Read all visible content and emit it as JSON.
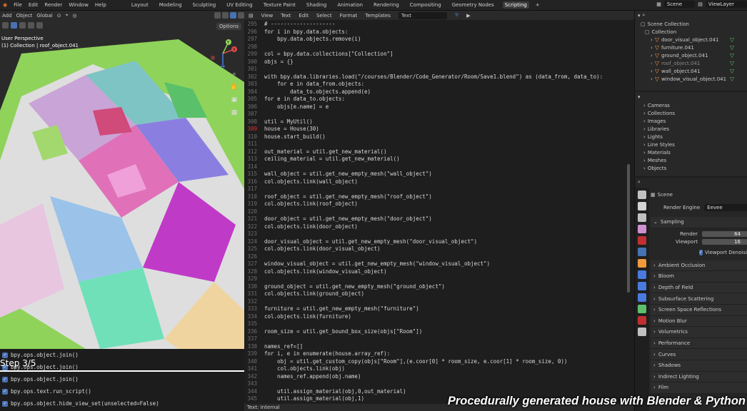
{
  "topbar": {
    "menus": [
      "File",
      "Edit",
      "Render",
      "Window",
      "Help"
    ],
    "workspaces": [
      "Layout",
      "Modeling",
      "Sculpting",
      "UV Editing",
      "Texture Paint",
      "Shading",
      "Animation",
      "Rendering",
      "Compositing",
      "Geometry Nodes",
      "Scripting"
    ],
    "active_workspace": "Scripting",
    "scene": "Scene",
    "view_layer": "ViewLayer"
  },
  "viewport": {
    "menus": [
      "Add",
      "Object"
    ],
    "transform": "Global",
    "options": "Options",
    "perspective": "User Perspective",
    "collection_info": "(1) Collection | roof_object.041",
    "gizmo_axes": [
      "X",
      "Y",
      "Z"
    ]
  },
  "console": {
    "lines": [
      "bpy.ops.object.join()",
      "bpy.ops.object.join()",
      "bpy.ops.object.join()",
      "bpy.ops.text.run_script()",
      "bpy.ops.object.hide_view_set(unselected=False)"
    ],
    "step": "Step 3/5"
  },
  "editor": {
    "menus": [
      "View",
      "Text",
      "Edit",
      "Select",
      "Format",
      "Templates"
    ],
    "text_name": "Text",
    "footer": "Text: Internal",
    "lines": [
      {
        "n": "295",
        "t": "# --------------------"
      },
      {
        "n": "296",
        "t": "for i in bpy.data.objects:"
      },
      {
        "n": "297",
        "t": "    bpy.data.objects.remove(i)"
      },
      {
        "n": "298",
        "t": ""
      },
      {
        "n": "299",
        "t": "col = bpy.data.collections[\"Collection\"]"
      },
      {
        "n": "300",
        "t": "objs = {}"
      },
      {
        "n": "301",
        "t": ""
      },
      {
        "n": "302",
        "t": "with bpy.data.libraries.load(\"/courses/Blender/Code_Generator/Room/Save1.blend\") as (data_from, data_to):"
      },
      {
        "n": "303",
        "t": "    for e in data_from.objects:"
      },
      {
        "n": "304",
        "t": "        data_to.objects.append(e)"
      },
      {
        "n": "305",
        "t": "for e in data_to.objects:"
      },
      {
        "n": "306",
        "t": "    objs[e.name] = e"
      },
      {
        "n": "307",
        "t": ""
      },
      {
        "n": "308",
        "t": "util = MyUtil()"
      },
      {
        "n": "309",
        "t": "house = House(30)"
      },
      {
        "n": "310",
        "t": "house.start_build()"
      },
      {
        "n": "311",
        "t": ""
      },
      {
        "n": "312",
        "t": "out_material = util.get_new_material()"
      },
      {
        "n": "313",
        "t": "ceiling_material = util.get_new_material()"
      },
      {
        "n": "314",
        "t": ""
      },
      {
        "n": "315",
        "t": "wall_object = util.get_new_empty_mesh(\"wall_object\")"
      },
      {
        "n": "316",
        "t": "col.objects.link(wall_object)"
      },
      {
        "n": "317",
        "t": ""
      },
      {
        "n": "318",
        "t": "roof_object = util.get_new_empty_mesh(\"roof_object\")"
      },
      {
        "n": "319",
        "t": "col.objects.link(roof_object)"
      },
      {
        "n": "320",
        "t": ""
      },
      {
        "n": "321",
        "t": "door_object = util.get_new_empty_mesh(\"door_object\")"
      },
      {
        "n": "322",
        "t": "col.objects.link(door_object)"
      },
      {
        "n": "323",
        "t": ""
      },
      {
        "n": "324",
        "t": "door_visual_object = util.get_new_empty_mesh(\"door_visual_object\")"
      },
      {
        "n": "325",
        "t": "col.objects.link(door_visual_object)"
      },
      {
        "n": "326",
        "t": ""
      },
      {
        "n": "327",
        "t": "window_visual_object = util.get_new_empty_mesh(\"window_visual_object\")"
      },
      {
        "n": "328",
        "t": "col.objects.link(window_visual_object)"
      },
      {
        "n": "329",
        "t": ""
      },
      {
        "n": "330",
        "t": "ground_object = util.get_new_empty_mesh(\"ground_object\")"
      },
      {
        "n": "331",
        "t": "col.objects.link(ground_object)"
      },
      {
        "n": "332",
        "t": ""
      },
      {
        "n": "333",
        "t": "furniture = util.get_new_empty_mesh(\"furniture\")"
      },
      {
        "n": "334",
        "t": "col.objects.link(furniture)"
      },
      {
        "n": "335",
        "t": ""
      },
      {
        "n": "336",
        "t": "room_size = util.get_bound_box_size(objs[\"Room\"])"
      },
      {
        "n": "337",
        "t": ""
      },
      {
        "n": "338",
        "t": "names_ref=[]"
      },
      {
        "n": "339",
        "t": "for i, e in enumerate(house.array_ref):"
      },
      {
        "n": "340",
        "t": "    obj = util.get_custom_copy(objs[\"Room\"],(e.coor[0] * room_size, e.coor[1] * room_size, 0))"
      },
      {
        "n": "341",
        "t": "    col.objects.link(obj)"
      },
      {
        "n": "342",
        "t": "    names_ref.append(obj.name)"
      },
      {
        "n": "343",
        "t": ""
      },
      {
        "n": "344",
        "t": "    util.assign_material(obj,0,out_material)"
      },
      {
        "n": "345",
        "t": "    util.assign_material(obj,1)"
      }
    ]
  },
  "outliner": {
    "root": "Scene Collection",
    "collection": "Collection",
    "items": [
      "door_visual_object.041",
      "furniture.041",
      "ground_object.041",
      "roof_object.041",
      "wall_object.041",
      "window_visual_object.041"
    ]
  },
  "data_browser": {
    "items": [
      "Cameras",
      "Collections",
      "Images",
      "Libraries",
      "Lights",
      "Line Styles",
      "Materials",
      "Meshes",
      "Objects"
    ]
  },
  "properties": {
    "scene": "Scene",
    "render_engine_label": "Render Engine",
    "render_engine": "Eevee",
    "sampling": "Sampling",
    "render_label": "Render",
    "render_value": "64",
    "viewport_label": "Viewport",
    "viewport_value": "16",
    "denoise": "Viewport Denoising",
    "sections": [
      "Ambient Occlusion",
      "Bloom",
      "Depth of Field",
      "Subsurface Scattering",
      "Screen Space Reflections",
      "Motion Blur",
      "Volumetrics",
      "Performance",
      "Curves",
      "Shadows",
      "Indirect Lighting",
      "Film"
    ]
  },
  "caption": "Procedurally generated house with Blender & Python",
  "colors": {
    "accent": "#4772b3",
    "grass": "#8fd35a",
    "object_orange": "#f09a3b"
  }
}
